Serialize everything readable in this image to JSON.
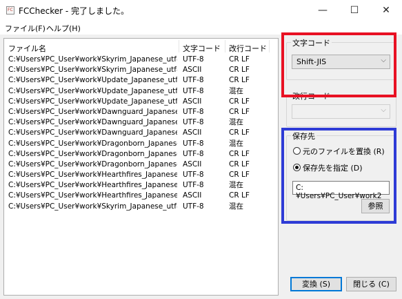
{
  "window": {
    "icon_text": "FC",
    "title": "FCChecker - 完了しました。",
    "controls": {
      "minimize": "—",
      "maximize": "☐",
      "close": "✕"
    }
  },
  "menu": [
    "ファイル(F)",
    "ヘルプ(H)"
  ],
  "list": {
    "headers": [
      "ファイル名",
      "文字コード",
      "改行コード"
    ],
    "rows": [
      [
        "C:¥Users¥PC_User¥work¥Skyrim_Japanese_utf8...",
        "UTF-8",
        "CR LF"
      ],
      [
        "C:¥Users¥PC_User¥work¥Skyrim_Japanese_utf8...",
        "ASCII",
        "CR LF"
      ],
      [
        "C:¥Users¥PC_User¥work¥Update_Japanese_utf...",
        "UTF-8",
        "CR LF"
      ],
      [
        "C:¥Users¥PC_User¥work¥Update_Japanese_utf...",
        "UTF-8",
        "混在"
      ],
      [
        "C:¥Users¥PC_User¥work¥Update_Japanese_utf...",
        "ASCII",
        "CR LF"
      ],
      [
        "C:¥Users¥PC_User¥work¥Dawnguard_Japanese...",
        "UTF-8",
        "CR LF"
      ],
      [
        "C:¥Users¥PC_User¥work¥Dawnguard_Japanese...",
        "UTF-8",
        "混在"
      ],
      [
        "C:¥Users¥PC_User¥work¥Dawnguard_Japanese...",
        "ASCII",
        "CR LF"
      ],
      [
        "C:¥Users¥PC_User¥work¥Dragonborn_Japanese...",
        "UTF-8",
        "混在"
      ],
      [
        "C:¥Users¥PC_User¥work¥Dragonborn_Japanese...",
        "UTF-8",
        "CR LF"
      ],
      [
        "C:¥Users¥PC_User¥work¥Dragonborn_Japanese...",
        "ASCII",
        "CR LF"
      ],
      [
        "C:¥Users¥PC_User¥work¥Hearthfires_Japanese...",
        "UTF-8",
        "CR LF"
      ],
      [
        "C:¥Users¥PC_User¥work¥Hearthfires_Japanese...",
        "UTF-8",
        "混在"
      ],
      [
        "C:¥Users¥PC_User¥work¥Hearthfires_Japanese...",
        "ASCII",
        "CR LF"
      ],
      [
        "C:¥Users¥PC_User¥work¥Skyrim_Japanese_utf8...",
        "UTF-8",
        "混在"
      ]
    ]
  },
  "encoding": {
    "label": "文字コード",
    "selected": "Shift-JIS",
    "highlight_color": "#e81123"
  },
  "newline": {
    "label": "改行コード",
    "selected": ""
  },
  "destination": {
    "label": "保存先",
    "option_replace": "元のファイルを置換 (R)",
    "option_specify": "保存先を指定 (D)",
    "selected": "specify",
    "path": "C:¥Users¥PC_User¥work2",
    "browse": "参照",
    "highlight_color": "#2e3bd6"
  },
  "buttons": {
    "convert": "変換 (S)",
    "close": "閉じる (C)"
  }
}
